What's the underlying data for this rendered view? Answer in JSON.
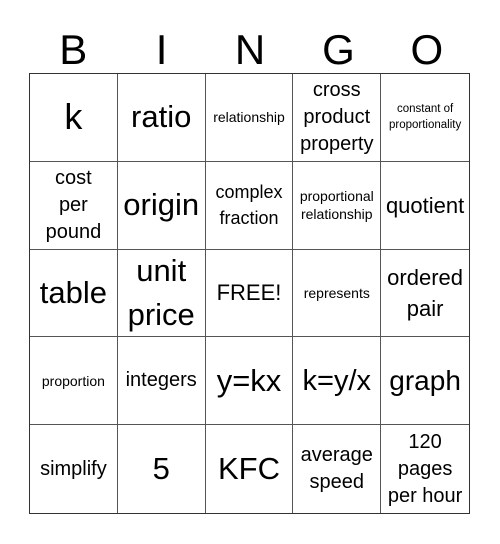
{
  "header": {
    "letters": [
      "B",
      "I",
      "N",
      "G",
      "O"
    ]
  },
  "cells": [
    "k",
    "ratio",
    "relationship",
    "cross product property",
    "constant of proportionality",
    "cost per pound",
    "origin",
    "complex fraction",
    "proportional relationship",
    "quotient",
    "table",
    "unit price",
    "FREE!",
    "represents",
    "ordered pair",
    "proportion",
    "integers",
    "y=kx",
    "k=y/x",
    "graph",
    "simplify",
    "5",
    "KFC",
    "average speed",
    "120 pages per hour"
  ],
  "cell_lines": [
    [
      "k"
    ],
    [
      "ratio"
    ],
    [
      "relationship"
    ],
    [
      "cross",
      "product",
      "property"
    ],
    [
      "constant of",
      "proportionality"
    ],
    [
      "cost",
      "per",
      "pound"
    ],
    [
      "origin"
    ],
    [
      "complex",
      "fraction"
    ],
    [
      "proportional",
      "relationship"
    ],
    [
      "quotient"
    ],
    [
      "table"
    ],
    [
      "unit",
      "price"
    ],
    [
      "FREE!"
    ],
    [
      "represents"
    ],
    [
      "ordered",
      "pair"
    ],
    [
      "proportion"
    ],
    [
      "integers"
    ],
    [
      "y=kx"
    ],
    [
      "k=y/x"
    ],
    [
      "graph"
    ],
    [
      "simplify"
    ],
    [
      "5"
    ],
    [
      "KFC"
    ],
    [
      "average",
      "speed"
    ],
    [
      "120",
      "pages",
      "per hour"
    ]
  ]
}
